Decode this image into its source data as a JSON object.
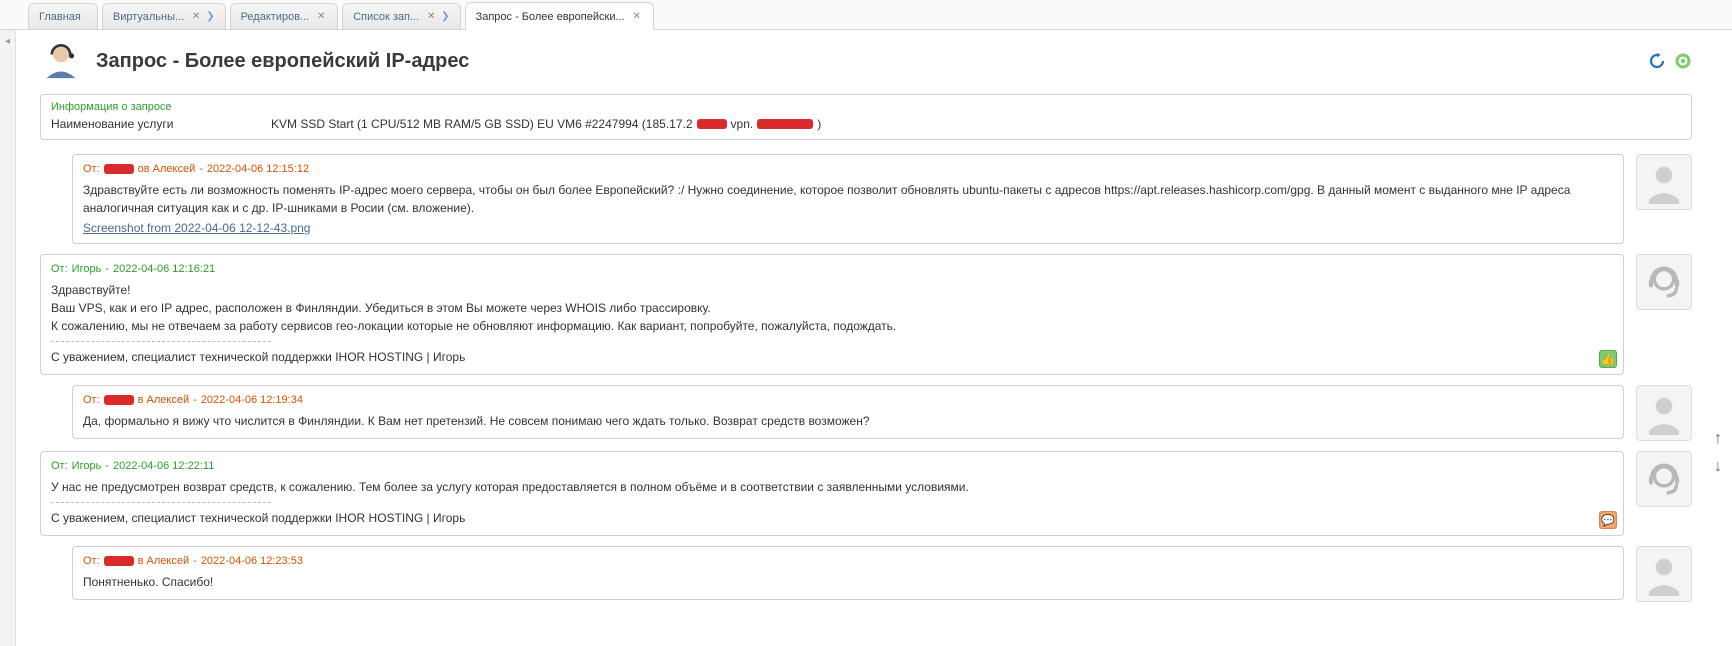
{
  "tabs": [
    {
      "label": "Главная",
      "closable": false
    },
    {
      "label": "Виртуальны...",
      "closable": true,
      "chevron": true
    },
    {
      "label": "Редактиров...",
      "closable": true
    },
    {
      "label": "Список зап...",
      "closable": true,
      "chevron": true
    },
    {
      "label": "Запрос - Более европейски...",
      "closable": true,
      "active": true
    }
  ],
  "header": {
    "title": "Запрос - Более европейский IP-адрес"
  },
  "info": {
    "title": "Информация о запросе",
    "label": "Наименование услуги",
    "value_prefix": "KVM SSD Start (1 CPU/512 MB RAM/5 GB SSD) EU VM6 #2247994 (185.17.2",
    "value_mid": " vpn.",
    "value_suffix": ")"
  },
  "messages": [
    {
      "who": "user",
      "from_prefix": "От: ",
      "name_suffix": "ов Алексей",
      "ts": "2022-04-06 12:15:12",
      "body": "Здравствуйте есть ли возможность поменять IP-адрес моего сервера, чтобы он был более Европейский? :/ Нужно соединение, которое позволит обновлять ubuntu-пакеты с адресов https://apt.releases.hashicorp.com/gpg. В данный момент с выданного мне IP адреса аналогичная ситуация как и с др. IP-шниками в Росии (см. вложение).",
      "attachment": "Screenshot from 2022-04-06 12-12-43.png",
      "indent": true
    },
    {
      "who": "staff",
      "from_prefix": "От: ",
      "name": "Игорь",
      "ts": "2022-04-06 12:16:21",
      "body_lines": [
        "Здравствуйте!",
        "Ваш VPS, как и его IP адрес, расположен в Финляндии. Убедиться в этом Вы можете через WHOIS либо трассировку.",
        "К сожалению, мы не отвечаем за работу сервисов гео-локации которые не обновляют информацию. Как вариант, попробуйте, пожалуйста, подождать."
      ],
      "signature": "С уважением, специалист технической поддержки IHOR HOSTING | Игорь",
      "rating": "up",
      "indent": false
    },
    {
      "who": "user",
      "from_prefix": "От: ",
      "name_suffix": "в Алексей",
      "ts": "2022-04-06 12:19:34",
      "body": "Да, формально я вижу что числится в Финляндии. К Вам нет претензий. Не совсем понимаю чего ждать только. Возврат средств возможен?",
      "indent": true
    },
    {
      "who": "staff",
      "from_prefix": "От: ",
      "name": "Игорь",
      "ts": "2022-04-06 12:22:11",
      "body": "У нас не предусмотрен возврат средств, к сожалению. Тем более за услугу которая предоставляется в полном объёме и в соответствии с заявленными условиями.",
      "signature": "С уважением, специалист технической поддержки IHOR HOSTING | Игорь",
      "rating": "down",
      "indent": false
    },
    {
      "who": "user",
      "from_prefix": "От: ",
      "name_suffix": "в Алексей",
      "ts": "2022-04-06 12:23:53",
      "body": "Понятненько. Спасибо!",
      "indent": true
    }
  ]
}
